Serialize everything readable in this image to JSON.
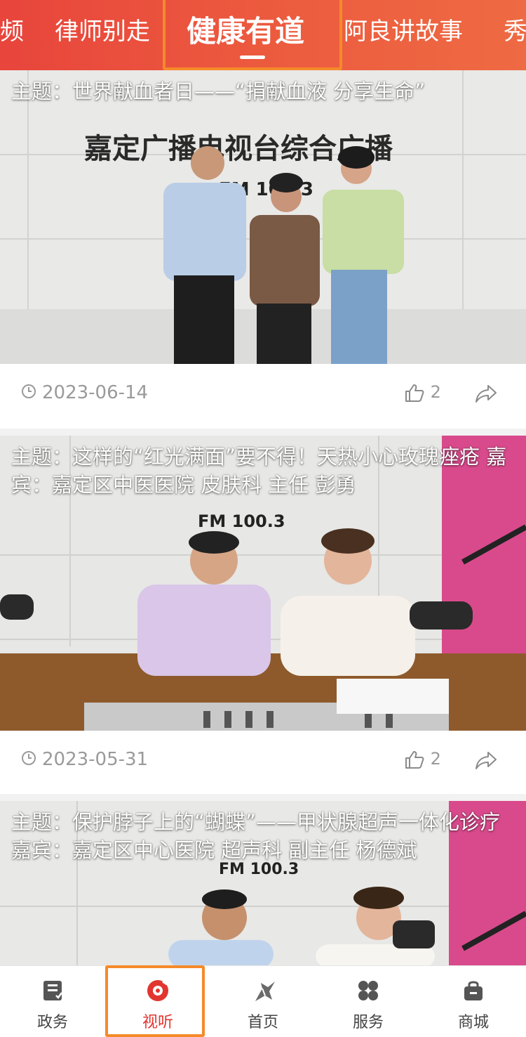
{
  "top_tabs": [
    {
      "label": "频"
    },
    {
      "label": "律师别走"
    },
    {
      "label": "健康有道"
    },
    {
      "label": "阿良讲故事"
    },
    {
      "label": "秀"
    }
  ],
  "active_tab": "健康有道",
  "feed": [
    {
      "title": "主题：世界献血者日——“捐献血液 分享生命”",
      "image_text": "嘉定广播电视台综合广播",
      "fm": "FM 100.3",
      "date": "2023-06-14",
      "likes": "2"
    },
    {
      "title": "主题：这样的“红光满面”要不得！天热小心玫瑰痤疮 嘉宾：嘉定区中医医院 皮肤科 主任 彭勇",
      "fm": "FM 100.3",
      "date": "2023-05-31",
      "likes": "2"
    },
    {
      "title": "主题：保护脖子上的“蝴蝶”——甲状腺超声一体化诊疗 嘉宾：嘉定区中心医院 超声科 副主任 杨德斌",
      "fm": "FM 100.3"
    }
  ],
  "bottom_nav": [
    {
      "label": "政务",
      "icon": "document-icon"
    },
    {
      "label": "视听",
      "icon": "play-disc-icon"
    },
    {
      "label": "首页",
      "icon": "home-logo-icon"
    },
    {
      "label": "服务",
      "icon": "grid-icon"
    },
    {
      "label": "商城",
      "icon": "shopping-bag-icon"
    }
  ],
  "active_nav": "视听",
  "colors": {
    "brand_red": "#e8453c",
    "active_nav": "#e2352f",
    "highlight_box": "#f58a2a"
  }
}
